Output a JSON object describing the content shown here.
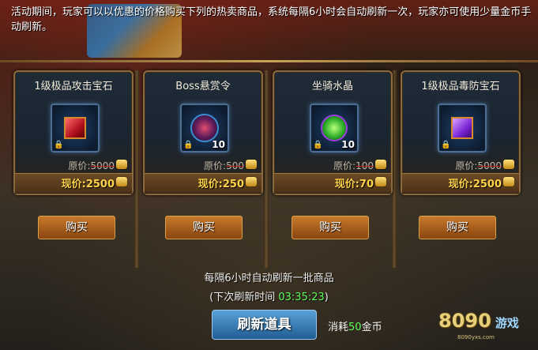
{
  "notice": "活动期间，玩家可以以优惠的价格购买下列的热卖商品，系统每隔6小时会自动刷新一次，玩家亦可使用少量金币手动刷新。",
  "items": [
    {
      "name": "1级极品攻击宝石",
      "orig_label": "原价:",
      "orig_price": "5000",
      "now_label": "现价:",
      "now_price": "2500",
      "count": "",
      "gem": "red-gem-icon",
      "buy": "购买"
    },
    {
      "name": "Boss悬赏令",
      "orig_label": "原价:",
      "orig_price": "500",
      "now_label": "现价:",
      "now_price": "250",
      "count": "10",
      "gem": "boss-token-icon",
      "buy": "购买"
    },
    {
      "name": "坐骑水晶",
      "orig_label": "原价:",
      "orig_price": "100",
      "now_label": "现价:",
      "now_price": "70",
      "count": "10",
      "gem": "mount-crystal-icon",
      "buy": "购买"
    },
    {
      "name": "1级极品毒防宝石",
      "orig_label": "原价:",
      "orig_price": "5000",
      "now_label": "现价:",
      "now_price": "2500",
      "count": "",
      "gem": "purple-gem-icon",
      "buy": "购买"
    }
  ],
  "refresh": {
    "line1": "每隔6小时自动刷新一批商品",
    "line2_prefix": "(下次刷新时间",
    "timer": "03:35:23",
    "line2_suffix": ")",
    "button": "刷新道具",
    "cost_prefix": "消耗",
    "cost_amount": "50",
    "cost_suffix": "金币"
  },
  "logo": {
    "main": "8090",
    "sub": "游戏",
    "url": "8090yxs.com"
  },
  "colors": {
    "gold": "#ffd34a",
    "green": "#5cff5c",
    "buy_button": "#b06a24",
    "refresh_button": "#2f73ae"
  }
}
